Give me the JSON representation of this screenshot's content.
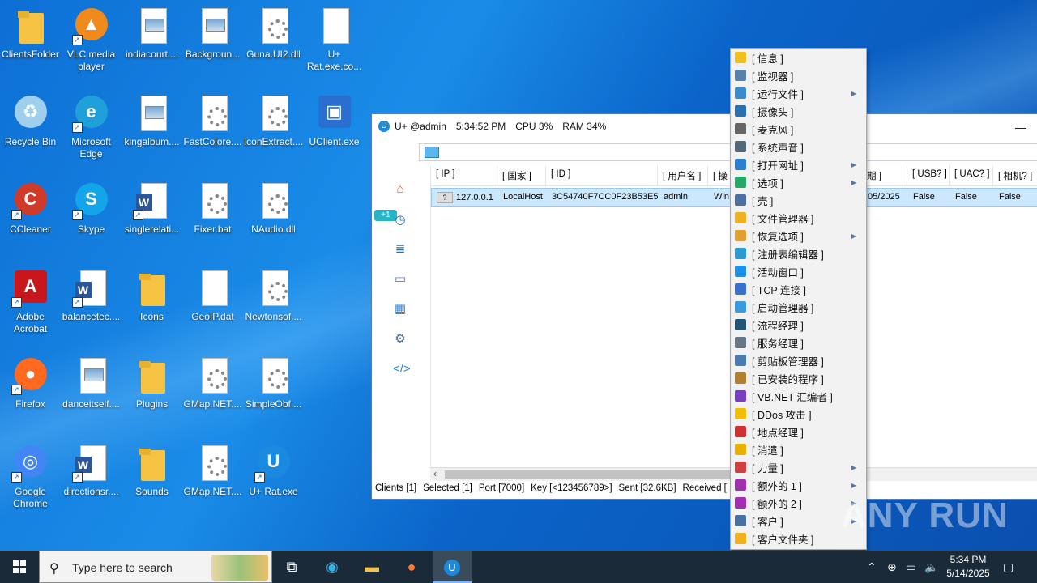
{
  "desktop": {
    "icons": [
      {
        "label": "ClientsFolder",
        "type": "folder"
      },
      {
        "label": "VLC media player",
        "type": "vlc"
      },
      {
        "label": "indiacourt....",
        "type": "image"
      },
      {
        "label": "Backgroun...",
        "type": "image"
      },
      {
        "label": "Guna.UI2.dll",
        "type": "gear"
      },
      {
        "label": "U+ Rat.exe.co...",
        "type": "blank"
      },
      {
        "label": "Recycle Bin",
        "type": "recycle"
      },
      {
        "label": "Microsoft Edge",
        "type": "edge"
      },
      {
        "label": "kingalbum....",
        "type": "image"
      },
      {
        "label": "FastColore....",
        "type": "gear"
      },
      {
        "label": "IconExtract....",
        "type": "gear"
      },
      {
        "label": "UClient.exe",
        "type": "app"
      },
      {
        "label": "CCleaner",
        "type": "ccleaner"
      },
      {
        "label": "Skype",
        "type": "skype"
      },
      {
        "label": "singlerelati...",
        "type": "word"
      },
      {
        "label": "Fixer.bat",
        "type": "gear"
      },
      {
        "label": "NAudio.dll",
        "type": "gear"
      },
      {
        "label": "Adobe Acrobat",
        "type": "acrobat"
      },
      {
        "label": "balancetec....",
        "type": "word"
      },
      {
        "label": "Icons",
        "type": "folder"
      },
      {
        "label": "GeoIP.dat",
        "type": "blank"
      },
      {
        "label": "Newtonsof....",
        "type": "gear"
      },
      {
        "label": "Firefox",
        "type": "firefox"
      },
      {
        "label": "danceitself....",
        "type": "image"
      },
      {
        "label": "Plugins",
        "type": "folder"
      },
      {
        "label": "GMap.NET....",
        "type": "gear"
      },
      {
        "label": "SimpleObf....",
        "type": "gear"
      },
      {
        "label": "Google Chrome",
        "type": "chrome"
      },
      {
        "label": "directionsr....",
        "type": "word"
      },
      {
        "label": "Sounds",
        "type": "folder"
      },
      {
        "label": "GMap.NET....",
        "type": "gear"
      },
      {
        "label": "U+ Rat.exe",
        "type": "urat"
      }
    ]
  },
  "window": {
    "title_app": "U+ @admin",
    "time": "5:34:52 PM",
    "cpu": "CPU 3%",
    "ram": "RAM 34%",
    "minimize": "—",
    "badge": "+1",
    "columns": [
      "[ IP ]",
      "[ 国家 ]",
      "[ ID ]",
      "[ 用户名 ]",
      "[ 操",
      "期 ]",
      "[ USB? ]",
      "[ UAC? ]",
      "[ 相机? ]"
    ],
    "row": [
      "127.0.0.1",
      "LocalHost",
      "3C54740F7CC0F23B53E5",
      "admin",
      "Win",
      "05/2025",
      "False",
      "False",
      "False"
    ],
    "status": [
      "Clients [1]",
      "Selected [1]",
      "Port [7000]",
      "Key [<123456789>]",
      "Sent [32.6KB]",
      "Received ["
    ]
  },
  "menu": {
    "items": [
      {
        "label": "[ 信息 ]",
        "icon": "info-icon",
        "color": "#f0c020",
        "sub": false
      },
      {
        "label": "[ 监视器 ]",
        "icon": "monitor-icon",
        "color": "#5a7fa8",
        "sub": false
      },
      {
        "label": "[ 运行文件 ]",
        "icon": "run-file-icon",
        "color": "#3a8ad0",
        "sub": true
      },
      {
        "label": "[ 摄像头 ]",
        "icon": "webcam-icon",
        "color": "#2a6fb0",
        "sub": false
      },
      {
        "label": "[ 麦克风 ]",
        "icon": "microphone-icon",
        "color": "#666666",
        "sub": false
      },
      {
        "label": "[ 系统声音 ]",
        "icon": "speaker-icon",
        "color": "#556677",
        "sub": false
      },
      {
        "label": "[ 打开网址 ]",
        "icon": "globe-icon",
        "color": "#2a7fd0",
        "sub": true
      },
      {
        "label": "[ 选项 ]",
        "icon": "options-icon",
        "color": "#22aa66",
        "sub": true
      },
      {
        "label": "[ 壳 ]",
        "icon": "code-icon",
        "color": "#4a6fa0",
        "sub": false
      },
      {
        "label": "[ 文件管理器 ]",
        "icon": "folder-icon",
        "color": "#f0b020",
        "sub": false
      },
      {
        "label": "[ 恢复选项 ]",
        "icon": "recovery-icon",
        "color": "#e0a030",
        "sub": true
      },
      {
        "label": "[ 注册表编辑器 ]",
        "icon": "registry-icon",
        "color": "#2a9ad0",
        "sub": false
      },
      {
        "label": "[ 活动窗口 ]",
        "icon": "windows-icon",
        "color": "#1e90e8",
        "sub": false
      },
      {
        "label": "[ TCP 连接 ]",
        "icon": "tcp-icon",
        "color": "#3a6fd0",
        "sub": false
      },
      {
        "label": "[ 启动管理器 ]",
        "icon": "startup-icon",
        "color": "#3a9ae0",
        "sub": false
      },
      {
        "label": "[ 流程经理 ]",
        "icon": "process-icon",
        "color": "#225577",
        "sub": false
      },
      {
        "label": "[ 服务经理 ]",
        "icon": "service-icon",
        "color": "#667788",
        "sub": false
      },
      {
        "label": "[ 剪贴板管理器 ]",
        "icon": "clipboard-icon",
        "color": "#4a7ab0",
        "sub": false
      },
      {
        "label": "[ 已安装的程序 ]",
        "icon": "installed-icon",
        "color": "#b08030",
        "sub": false
      },
      {
        "label": "[ VB.NET 汇编者 ]",
        "icon": "vbnet-icon",
        "color": "#7a3fc0",
        "sub": false
      },
      {
        "label": "[ DDos 攻击 ]",
        "icon": "lightning-icon",
        "color": "#f0c000",
        "sub": false
      },
      {
        "label": "[ 地点经理 ]",
        "icon": "map-pin-icon",
        "color": "#d03030",
        "sub": false
      },
      {
        "label": "[ 消遣 ]",
        "icon": "crown-icon",
        "color": "#e8b000",
        "sub": false
      },
      {
        "label": "[ 力量 ]",
        "icon": "power-icon",
        "color": "#d04040",
        "sub": true
      },
      {
        "label": "[ 额外的 1 ]",
        "icon": "plus-icon",
        "color": "#a030b0",
        "sub": true
      },
      {
        "label": "[ 额外的 2 ]",
        "icon": "plus-icon",
        "color": "#a030b0",
        "sub": true
      },
      {
        "label": "[ 客户 ]",
        "icon": "client-icon",
        "color": "#4a6fa0",
        "sub": true
      },
      {
        "label": "[ 客户文件夹 ]",
        "icon": "client-folder-icon",
        "color": "#f0b020",
        "sub": false
      }
    ]
  },
  "taskbar": {
    "search_placeholder": "Type here to search",
    "time": "5:34 PM",
    "date": "5/14/2025"
  },
  "watermark": "ANY RUN"
}
